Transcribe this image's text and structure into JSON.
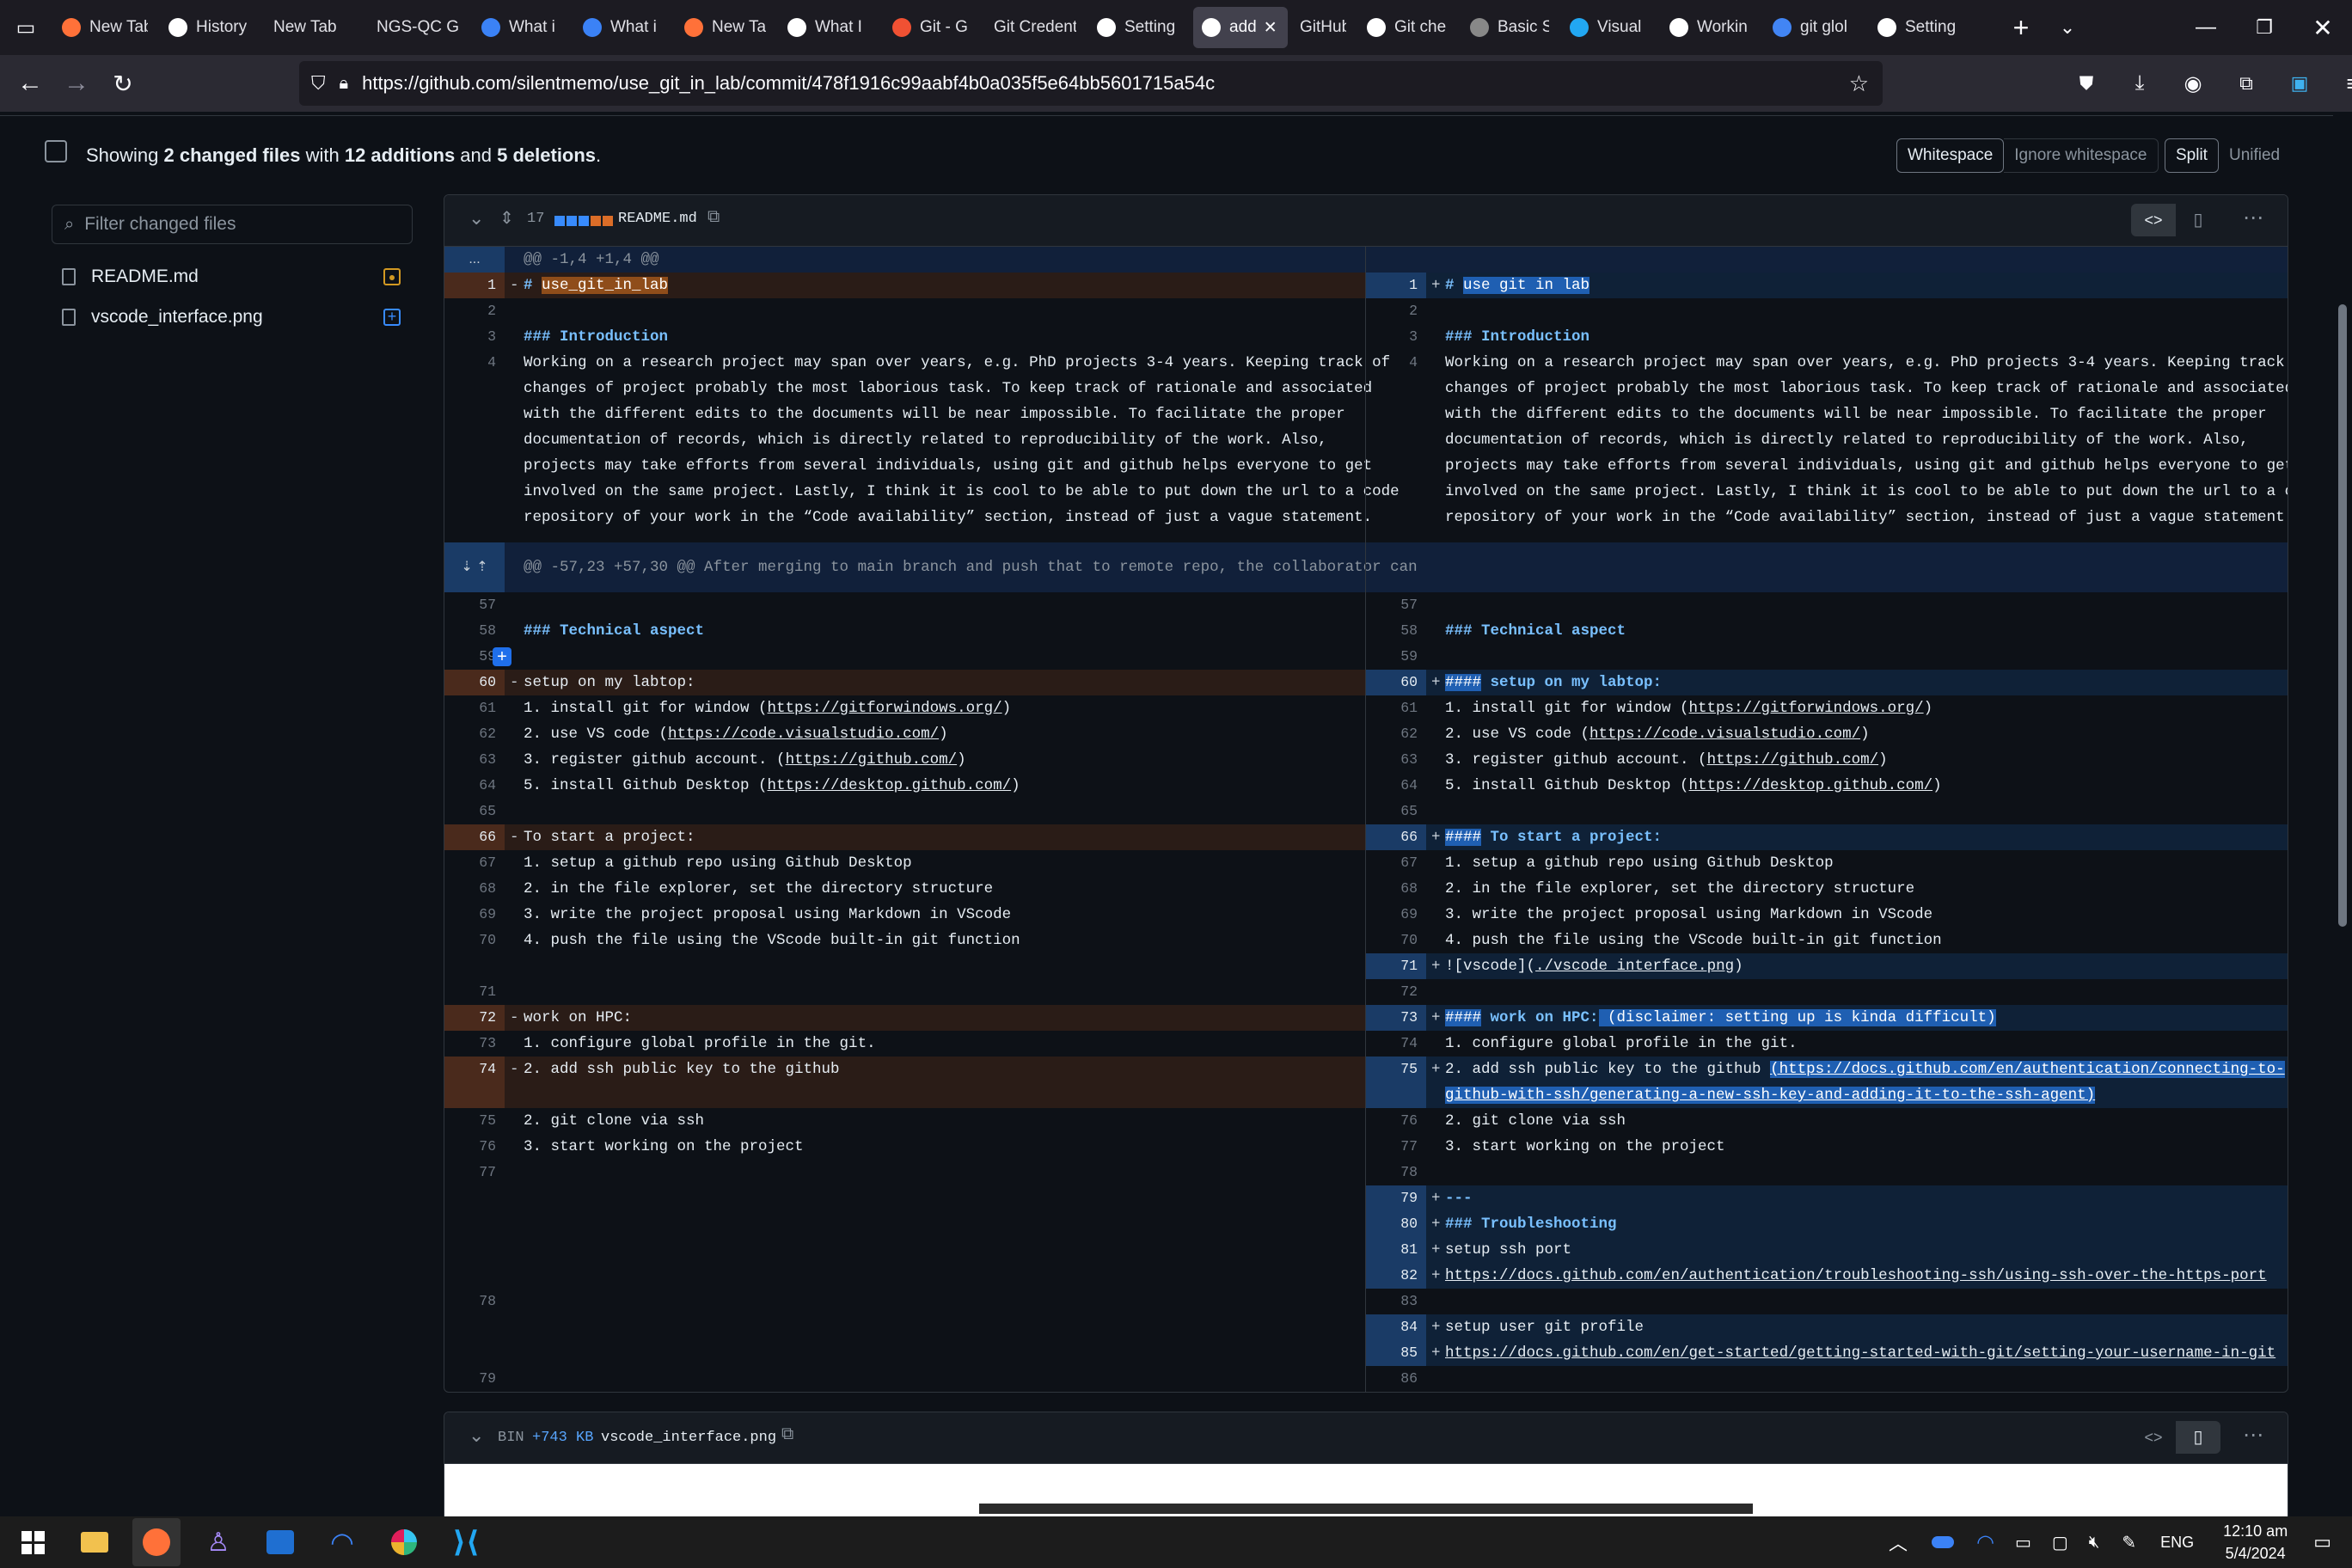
{
  "browser": {
    "tabs": [
      {
        "title": "New Tab",
        "icon": "firefox-icon",
        "color": "#ff7139"
      },
      {
        "title": "History",
        "icon": "history-icon",
        "color": "#ffffff"
      },
      {
        "title": "New Tab",
        "icon": "",
        "color": ""
      },
      {
        "title": "NGS-QC G",
        "icon": "",
        "color": ""
      },
      {
        "title": "What i",
        "icon": "vscode-like-icon",
        "color": "#3b82f6"
      },
      {
        "title": "What i",
        "icon": "vscode-like-icon",
        "color": "#3b82f6"
      },
      {
        "title": "New Ta",
        "icon": "firefox-icon",
        "color": "#ff7139"
      },
      {
        "title": "What I",
        "icon": "page-icon",
        "color": "#ffffff"
      },
      {
        "title": "Git - G",
        "icon": "git-icon",
        "color": "#f05133"
      },
      {
        "title": "Git Credent",
        "icon": "",
        "color": ""
      },
      {
        "title": "Setting",
        "icon": "gear-icon",
        "color": "#ffffff"
      },
      {
        "title": "add",
        "icon": "github-icon",
        "color": "#ffffff",
        "active": true
      },
      {
        "title": "GitHub",
        "icon": "",
        "color": ""
      },
      {
        "title": "Git che",
        "icon": "copilot-icon",
        "color": "#ffffff"
      },
      {
        "title": "Basic S",
        "icon": "page-icon",
        "color": "#888"
      },
      {
        "title": "Visual",
        "icon": "vscode-icon",
        "color": "#22a7f2"
      },
      {
        "title": "Workin",
        "icon": "github-icon",
        "color": "#ffffff"
      },
      {
        "title": "git glol",
        "icon": "google-icon",
        "color": "#4285f4"
      },
      {
        "title": "Setting",
        "icon": "github-icon",
        "color": "#ffffff"
      }
    ],
    "url": "https://github.com/silentmemo/use_git_in_lab/commit/478f1916c99aabf4b0a035f5e64bb5601715a54c"
  },
  "summary": {
    "prefix": "Showing ",
    "files": "2 changed files",
    "with": " with ",
    "additions": "12 additions",
    "and": " and ",
    "deletions": "5 deletions",
    "suffix": "."
  },
  "toolbar": {
    "whitespace": "Whitespace",
    "ignore_whitespace": "Ignore whitespace",
    "split": "Split",
    "unified": "Unified"
  },
  "sidebar": {
    "filter_placeholder": "Filter changed files",
    "files": [
      {
        "name": "README.md",
        "status": "modified"
      },
      {
        "name": "vscode_interface.png",
        "status": "added"
      }
    ]
  },
  "file1": {
    "count": "17",
    "name": "README.md",
    "hunk1": "@@ -1,4 +1,4 @@",
    "hunk2": "@@ -57,23 +57,30 @@ After merging to main branch and push that to remote repo, the collaborator can"
  },
  "file2": {
    "bin": "BIN",
    "size": "+743 KB",
    "name": "vscode_interface.png"
  },
  "intro_lines": [
    "Working on a research project may span over years, e.g. PhD projects 3-4 years. Keeping track of",
    "changes of project probably the most laborious task. To keep track of rationale and associated",
    "with the different edits to the documents will be near impossible. To facilitate the proper",
    "documentation of records, which is directly related to reproducibility of the work. Also,",
    "projects may take efforts from several individuals, using git and github helps everyone to get",
    "involved on the same project. Lastly, I think it is cool to be able to put down the url to a code",
    "repository of your work in the “Code availability” section, instead of just a vague statement."
  ],
  "left": {
    "title": "use_git_in_lab",
    "intro": "### Introduction",
    "tech": "### Technical aspect",
    "setup": "setup on my labtop:",
    "s1": "1. install git for window (",
    "s1u": "https://gitforwindows.org/",
    "s2": "2. use VS code (",
    "s2u": "https://code.visualstudio.com/",
    "s3": "3. register github account. (",
    "s3u": "https://github.com/",
    "s5": "5. install Github Desktop (",
    "s5u": "https://desktop.github.com/",
    "start": "To start a project:",
    "p1": "1. setup a github repo using Github Desktop",
    "p2": "2. in the file explorer, set the directory structure",
    "p3": "3. write the project proposal using Markdown in VScode",
    "p4": "4. push the file using the VScode built-in git function",
    "hpc": "work on HPC:",
    "h1": "1. configure global profile in the git.",
    "h2": "2. add ssh public key to the github",
    "h3": "2. git clone via ssh",
    "h4": "3. start working on the project"
  },
  "right": {
    "title": "use git in lab",
    "setup_hash": "####",
    "setup": " setup on my labtop:",
    "start_hash": "####",
    "start": " To start a project:",
    "img": "![vscode](",
    "imgu": "./vscode_interface.png",
    "hpc_hash": "####",
    "hpc": " work on HPC:",
    "hpc_note": " (disclaimer: setting up is kinda difficult)",
    "h2": "2. add ssh public key to the github ",
    "h2u_a": "(https://docs.github.com/en/authentication/connecting-to-",
    "h2u_b": "github-with-ssh/generating-a-new-ssh-key-and-adding-it-to-the-ssh-agent)",
    "sep": "---",
    "trouble": "### Troubleshooting",
    "port": "setup ssh port",
    "portu": "https://docs.github.com/en/authentication/troubleshooting-ssh/using-ssh-over-the-https-port",
    "profile": "setup user git profile",
    "profileu": "https://docs.github.com/en/get-started/getting-started-with-git/setting-your-username-in-git"
  },
  "ellipsis": "...",
  "taskbar": {
    "lang": "ENG",
    "time": "12:10 am",
    "date": "5/4/2024"
  }
}
